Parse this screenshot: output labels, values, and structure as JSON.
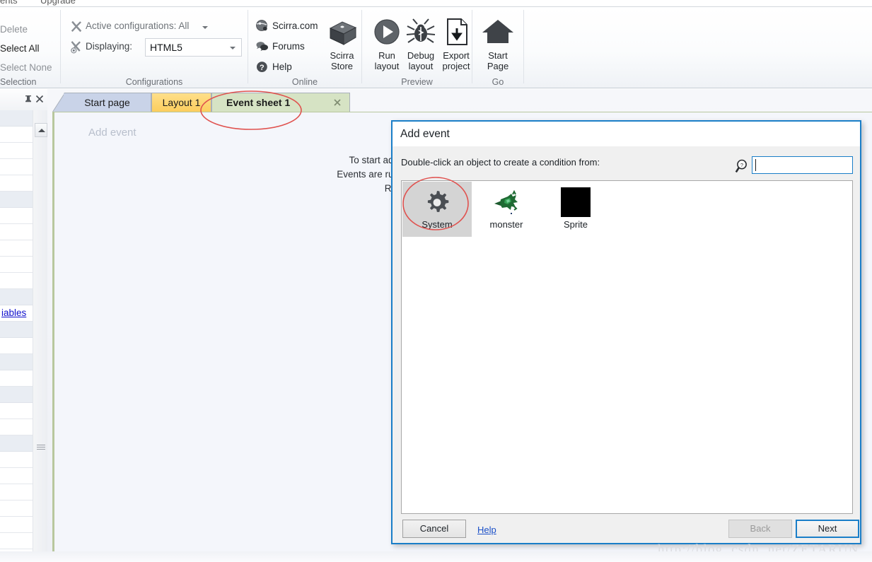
{
  "menu": {
    "items": [
      "ents",
      "Upgrade"
    ]
  },
  "ribbon": {
    "groups": {
      "selection": {
        "label": "Selection",
        "items": [
          "Delete",
          "Select All",
          "Select None"
        ]
      },
      "configurations": {
        "label": "Configurations",
        "active_label": "Active configurations: All",
        "displaying_label": "Displaying:",
        "displaying_value": "HTML5",
        "displaying_options": [
          "HTML5"
        ]
      },
      "online": {
        "label": "Online",
        "links": [
          "Scirra.com",
          "Forums",
          "Help"
        ],
        "store_label_line1": "Scirra",
        "store_label_line2": "Store"
      },
      "preview": {
        "label": "Preview",
        "buttons": [
          {
            "line1": "Run",
            "line2": "layout",
            "icon": "play-icon"
          },
          {
            "line1": "Debug",
            "line2": "layout",
            "icon": "bug-icon"
          },
          {
            "line1": "Export",
            "line2": "project",
            "icon": "export-icon"
          }
        ]
      },
      "go": {
        "label": "Go",
        "start_page_line1": "Start",
        "start_page_line2": "Page",
        "icon": "home-icon"
      }
    }
  },
  "left_panel": {
    "pin_icon": "pin-icon",
    "close_icon": "close-icon",
    "variables_link": "iables",
    "row_count": 28,
    "header_rows": [
      0,
      5,
      11,
      13,
      15,
      17,
      20
    ],
    "variables_row": 12
  },
  "editor": {
    "tabs": [
      {
        "label": "Start page",
        "color": "#c9d3e8",
        "active": false
      },
      {
        "label": "Layout 1",
        "color": "#fbcd5c",
        "active": false
      },
      {
        "label": "Event sheet 1",
        "color": "#d6e3c4",
        "active": true,
        "close_icon": "close-icon"
      }
    ],
    "sheet": {
      "add_event_label": "Add event",
      "hint_lines": [
        "To start add",
        "Events are run",
        "Rig"
      ]
    }
  },
  "dialog": {
    "title": "Add event",
    "instruction": "Double-click an object to create a condition from:",
    "search_icon": "search-help-icon",
    "search_value": "",
    "search_placeholder": "",
    "objects": [
      {
        "label": "System",
        "icon": "gear-icon",
        "selected": true
      },
      {
        "label": "monster",
        "icon": "monster-sprite-icon",
        "selected": false
      },
      {
        "label": "Sprite",
        "icon": "black-square-icon",
        "selected": false
      }
    ],
    "buttons": {
      "cancel": "Cancel",
      "help": "Help",
      "back": "Back",
      "next": "Next"
    },
    "back_enabled": false
  },
  "annotations": {
    "color": "#e0524f",
    "ellipses": [
      "event-sheet-tab-highlight",
      "system-object-highlight"
    ]
  },
  "watermark": "http://blog. csdn. net/ZETARUN",
  "colors": {
    "accent_blue": "#1a7ec8",
    "tab_active_green": "#d6e3c4",
    "tab_layout_yellow": "#fbcd5c",
    "tab_startpage_blue": "#c9d3e8",
    "annotation_red": "#e0524f"
  }
}
